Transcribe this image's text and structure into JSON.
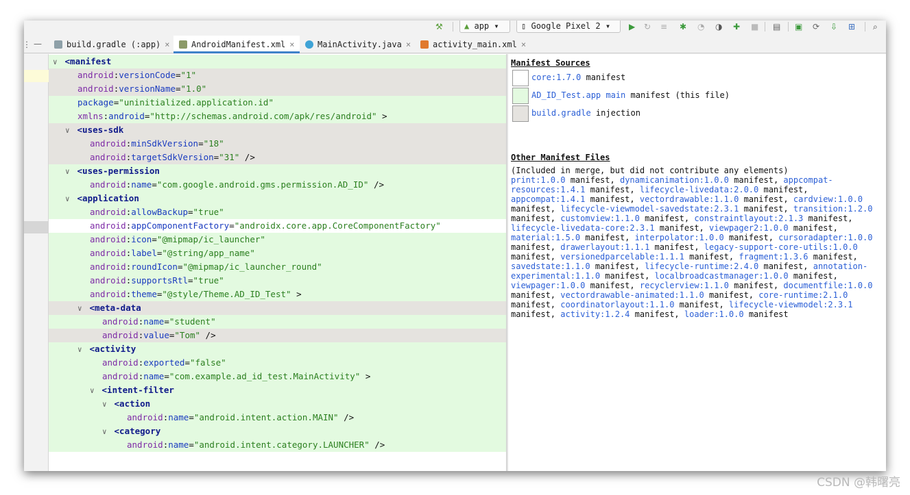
{
  "toolbar": {
    "run_config": "app",
    "device": "Google Pixel 2"
  },
  "tabs": [
    {
      "label": "build.gradle (:app)",
      "icon": "gradle-icon"
    },
    {
      "label": "AndroidManifest.xml",
      "icon": "manifest-file-icon",
      "active": true
    },
    {
      "label": "MainActivity.java",
      "icon": "java-class-icon"
    },
    {
      "label": "activity_main.xml",
      "icon": "layout-xml-icon"
    }
  ],
  "code": {
    "l1": "<manifest",
    "l2": {
      "ns": "android",
      "attr": "versionCode",
      "val": "\"1\""
    },
    "l3": {
      "ns": "android",
      "attr": "versionName",
      "val": "\"1.0\""
    },
    "l4": {
      "attr": "package",
      "val": "\"uninitialized.application.id\""
    },
    "l5": {
      "ns": "xmlns",
      "attr": "android",
      "val": "\"http://schemas.android.com/apk/res/android\"",
      "end": " >"
    },
    "l6": "<uses-sdk",
    "l7": {
      "ns": "android",
      "attr": "minSdkVersion",
      "val": "\"18\""
    },
    "l8": {
      "ns": "android",
      "attr": "targetSdkVersion",
      "val": "\"31\"",
      "end": " />"
    },
    "l9": "<uses-permission",
    "l10": {
      "ns": "android",
      "attr": "name",
      "val": "\"com.google.android.gms.permission.AD_ID\"",
      "end": " />"
    },
    "l11": "<application",
    "l12": {
      "ns": "android",
      "attr": "allowBackup",
      "val": "\"true\""
    },
    "l13": {
      "ns": "android",
      "attr": "appComponentFactory",
      "val": "\"androidx.core.app.CoreComponentFactory\""
    },
    "l14": {
      "ns": "android",
      "attr": "icon",
      "val": "\"@mipmap/ic_launcher\""
    },
    "l15": {
      "ns": "android",
      "attr": "label",
      "val": "\"@string/app_name\""
    },
    "l16": {
      "ns": "android",
      "attr": "roundIcon",
      "val": "\"@mipmap/ic_launcher_round\""
    },
    "l17": {
      "ns": "android",
      "attr": "supportsRtl",
      "val": "\"true\""
    },
    "l18": {
      "ns": "android",
      "attr": "theme",
      "val": "\"@style/Theme.AD_ID_Test\"",
      "end": " >"
    },
    "l19": "<meta-data",
    "l20": {
      "ns": "android",
      "attr": "name",
      "val": "\"student\""
    },
    "l21": {
      "ns": "android",
      "attr": "value",
      "val": "\"Tom\"",
      "end": " />"
    },
    "l22": "<activity",
    "l23": {
      "ns": "android",
      "attr": "exported",
      "val": "\"false\""
    },
    "l24": {
      "ns": "android",
      "attr": "name",
      "val": "\"com.example.ad_id_test.MainActivity\"",
      "end": " >"
    },
    "l25": "<intent-filter",
    "l26": "<action",
    "l27": {
      "ns": "android",
      "attr": "name",
      "val": "\"android.intent.action.MAIN\"",
      "end": " />"
    },
    "l28": "<category",
    "l29": {
      "ns": "android",
      "attr": "name",
      "val": "\"android.intent.category.LAUNCHER\"",
      "end": " />"
    },
    "colon": ":",
    "eq": "="
  },
  "panel": {
    "sources_title": "Manifest Sources",
    "sources": [
      {
        "link": "core:1.7.0",
        "text": " manifest",
        "color": "#ffffff"
      },
      {
        "link": "AD_ID_Test.app main",
        "text": " manifest (this file)",
        "color": "#e3fae0"
      },
      {
        "link": "build.gradle",
        "text": " injection",
        "color": "#e5e3df"
      }
    ],
    "other_title": "Other Manifest Files",
    "other_note": "(Included in merge, but did not contribute any elements)",
    "other_files": [
      "print:1.0.0",
      "dynamicanimation:1.0.0",
      "appcompat-resources:1.4.1",
      "lifecycle-livedata:2.0.0",
      "appcompat:1.4.1",
      "vectordrawable:1.1.0",
      "cardview:1.0.0",
      "lifecycle-viewmodel-savedstate:2.3.1",
      "transition:1.2.0",
      "customview:1.1.0",
      "constraintlayout:2.1.3",
      "lifecycle-livedata-core:2.3.1",
      "viewpager2:1.0.0",
      "material:1.5.0",
      "interpolator:1.0.0",
      "cursoradapter:1.0.0",
      "drawerlayout:1.1.1",
      "legacy-support-core-utils:1.0.0",
      "versionedparcelable:1.1.1",
      "fragment:1.3.6",
      "savedstate:1.1.0",
      "lifecycle-runtime:2.4.0",
      "annotation-experimental:1.1.0",
      "localbroadcastmanager:1.0.0",
      "viewpager:1.0.0",
      "recyclerview:1.1.0",
      "documentfile:1.0.0",
      "vectordrawable-animated:1.1.0",
      "core-runtime:2.1.0",
      "coordinatorlayout:1.1.0",
      "lifecycle-viewmodel:2.3.1",
      "activity:1.2.4",
      "loader:1.0.0"
    ],
    "manifest_word": "manifest"
  },
  "watermark": "CSDN @韩曙亮"
}
